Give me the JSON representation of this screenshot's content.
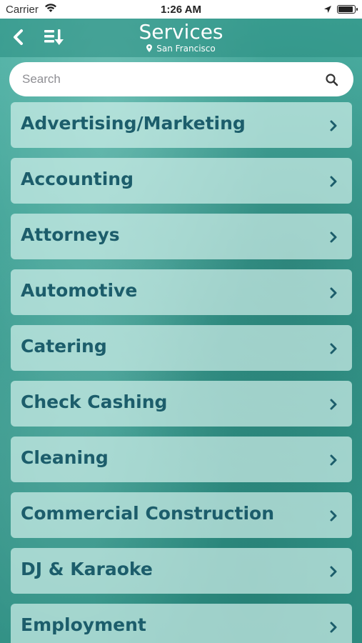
{
  "status_bar": {
    "carrier": "Carrier",
    "time": "1:26 AM"
  },
  "nav": {
    "title": "Services",
    "subtitle": "San Francisco",
    "back_icon": "chevron-left-icon",
    "sort_icon": "sort-list-icon"
  },
  "search": {
    "placeholder": "Search",
    "value": ""
  },
  "services": [
    {
      "label": "Advertising/Marketing"
    },
    {
      "label": "Accounting"
    },
    {
      "label": "Attorneys"
    },
    {
      "label": "Automotive"
    },
    {
      "label": "Catering"
    },
    {
      "label": "Check Cashing"
    },
    {
      "label": "Cleaning"
    },
    {
      "label": "Commercial Construction"
    },
    {
      "label": "DJ & Karaoke"
    },
    {
      "label": "Employment"
    }
  ],
  "colors": {
    "accent": "#3a9e93",
    "row_text": "#1c5d6b",
    "nav_text": "#ffffff"
  }
}
